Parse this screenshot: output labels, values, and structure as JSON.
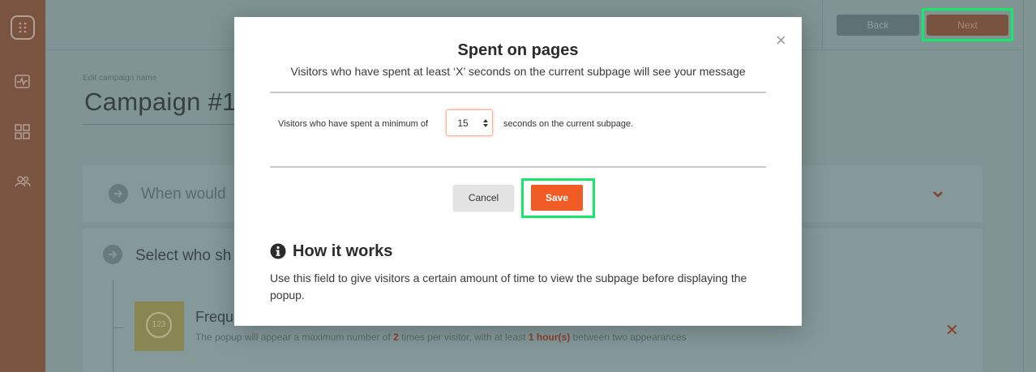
{
  "sidebar": {
    "icons": [
      "app-logo-icon",
      "activity-icon",
      "grid-icon",
      "users-icon"
    ]
  },
  "header": {
    "back_label": "Back",
    "next_label": "Next"
  },
  "campaign": {
    "name_label": "Edit campaign name",
    "name_value": "Campaign #1"
  },
  "sections": {
    "when_title": "When would",
    "select_title": "Select who sh",
    "frequency": {
      "title": "Freque",
      "icon_text": "123",
      "desc_prefix": "The popup will appear a maximum number of ",
      "times_value": "2",
      "desc_middle": " times per visitor, with at least ",
      "interval_value": "1 hour(s)",
      "desc_suffix": " between two appearances"
    }
  },
  "modal": {
    "title": "Spent on pages",
    "subtitle": "Visitors who have spent at least ‘X’ seconds on the current subpage will see your message",
    "min_label": "Visitors who have spent a minimum of",
    "seconds_value": "15",
    "sec_label": "seconds on the current subpage.",
    "cancel_label": "Cancel",
    "save_label": "Save",
    "how_title": "How it works",
    "how_desc": "Use this field to give visitors a certain amount of time to view the subpage before displaying the popup."
  },
  "colors": {
    "accent": "#f05a24",
    "highlight": "#16e86a",
    "sidebar": "#7a5341"
  }
}
